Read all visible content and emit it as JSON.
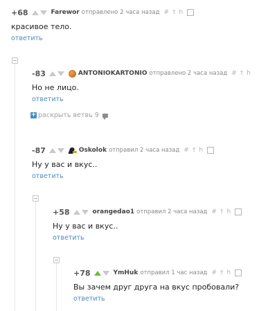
{
  "comments": [
    {
      "rating": "+68",
      "author": "Farewor",
      "posted": "отправлено 2 часа назад",
      "text": "красивое тело.",
      "reply": "ответить",
      "up_voted": false
    },
    {
      "rating": "-83",
      "author": "ANTONIOKARTONIO",
      "posted": "отправлено 2 часа назад",
      "text": "Но не лицо.",
      "reply": "ответить",
      "expand_branch": "раскрыть ветвь 9",
      "avatar": "orange-avatar-icon",
      "up_voted": false
    },
    {
      "rating": "-87",
      "author": "Oskolok",
      "posted": "отправил 2 часа назад",
      "text": "Ну у вас и вкус..",
      "reply": "ответить",
      "avatar": "black-figure-avatar-icon",
      "up_voted": false
    },
    {
      "rating": "+58",
      "author": "orangedao1",
      "posted": "отправил 2 часа назад",
      "text": "Ну у вас и вкус..",
      "reply": "ответить",
      "up_voted": false
    },
    {
      "rating": "+78",
      "author": "YmHuk",
      "posted": "отправил 1 час назад",
      "text": "Вы зачем друг друга на вкус пробовали?",
      "reply": "ответить",
      "up_voted": true
    }
  ],
  "tools": {
    "hash": "#",
    "pin": "†",
    "branch": "h"
  },
  "colors": {
    "link": "#4a8cc3",
    "upvote_active": "#6cbd33",
    "arrow_idle": "#c9c9c9"
  }
}
